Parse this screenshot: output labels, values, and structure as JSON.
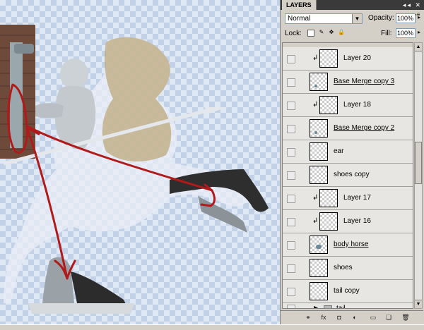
{
  "panel": {
    "title": "LAYERS",
    "window_buttons": "◂◂ ✕",
    "menu_button": "▸≡",
    "blend_mode": "Normal",
    "opacity_label": "Opacity:",
    "opacity_value": "100%",
    "lock_label": "Lock:",
    "fill_label": "Fill:",
    "fill_value": "100%"
  },
  "layers": [
    {
      "name": "Layer 20",
      "linked": true,
      "underline": false,
      "thumb": "empty"
    },
    {
      "name": "Base Merge copy 3",
      "linked": false,
      "underline": true,
      "thumb": "small"
    },
    {
      "name": "Layer 18",
      "linked": true,
      "underline": false,
      "thumb": "empty"
    },
    {
      "name": "Base Merge copy 2",
      "linked": false,
      "underline": true,
      "thumb": "small"
    },
    {
      "name": "ear",
      "linked": false,
      "underline": false,
      "thumb": "empty"
    },
    {
      "name": "shoes copy",
      "linked": false,
      "underline": false,
      "thumb": "empty"
    },
    {
      "name": "Layer 17",
      "linked": true,
      "underline": false,
      "thumb": "empty"
    },
    {
      "name": "Layer 16",
      "linked": true,
      "underline": false,
      "thumb": "empty"
    },
    {
      "name": "body horse",
      "linked": false,
      "underline": true,
      "thumb": "blob"
    },
    {
      "name": "shoes",
      "linked": false,
      "underline": false,
      "thumb": "empty"
    },
    {
      "name": "tail copy",
      "linked": false,
      "underline": false,
      "thumb": "empty"
    }
  ],
  "group": {
    "name": "tail"
  },
  "icons": {
    "link": "↲",
    "eye": "",
    "footer": [
      "link-layers-icon",
      "fx-icon",
      "mask-icon",
      "adjustment-icon",
      "new-group-icon",
      "new-layer-icon",
      "trash-icon"
    ]
  },
  "footer_glyphs": [
    "⚭",
    "fx",
    "◘",
    "◐",
    "▭",
    "❏",
    "🗑"
  ],
  "colors": {
    "panel_bg": "#d4d0c8",
    "title_bar": "#3a3a3a",
    "annotation_red": "#b11a1a",
    "canvas_check": "#c3d1e6"
  }
}
